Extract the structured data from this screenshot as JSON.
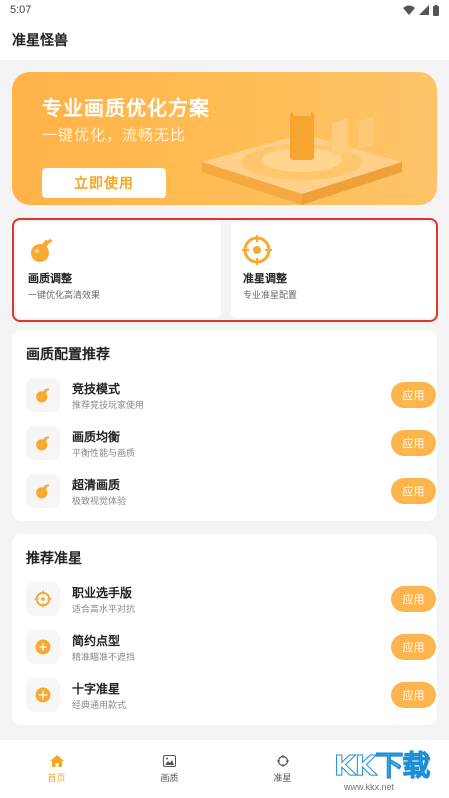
{
  "status": {
    "time": "5:07"
  },
  "app": {
    "title": "准星怪兽"
  },
  "banner": {
    "title": "专业画质优化方案",
    "subtitle": "一键优化，流畅无比",
    "button": "立即使用"
  },
  "quick": [
    {
      "title": "画质调整",
      "subtitle": "一键优化高清效果"
    },
    {
      "title": "准星调整",
      "subtitle": "专业准星配置"
    }
  ],
  "quality": {
    "title": "画质配置推荐",
    "items": [
      {
        "name": "竞技模式",
        "desc": "推荐竞技玩家使用",
        "action": "应用"
      },
      {
        "name": "画质均衡",
        "desc": "平衡性能与画质",
        "action": "应用"
      },
      {
        "name": "超清画质",
        "desc": "极致视觉体验",
        "action": "应用"
      }
    ]
  },
  "crosshair": {
    "title": "推荐准星",
    "items": [
      {
        "name": "职业选手版",
        "desc": "适合高水平对抗",
        "action": "应用"
      },
      {
        "name": "简约点型",
        "desc": "精准瞄准不遮挡",
        "action": "应用"
      },
      {
        "name": "十字准星",
        "desc": "经典通用款式",
        "action": "应用"
      }
    ]
  },
  "nav": [
    {
      "label": "首页",
      "icon": "home-icon"
    },
    {
      "label": "画质",
      "icon": "image-icon"
    },
    {
      "label": "准星",
      "icon": "crosshair-icon"
    }
  ],
  "watermark": {
    "text": "KK下载",
    "url": "www.kkx.net"
  },
  "colors": {
    "accent": "#f5a623",
    "apply": "#fcb54d",
    "highlight": "#e0342d",
    "banner": "#ffb247"
  }
}
